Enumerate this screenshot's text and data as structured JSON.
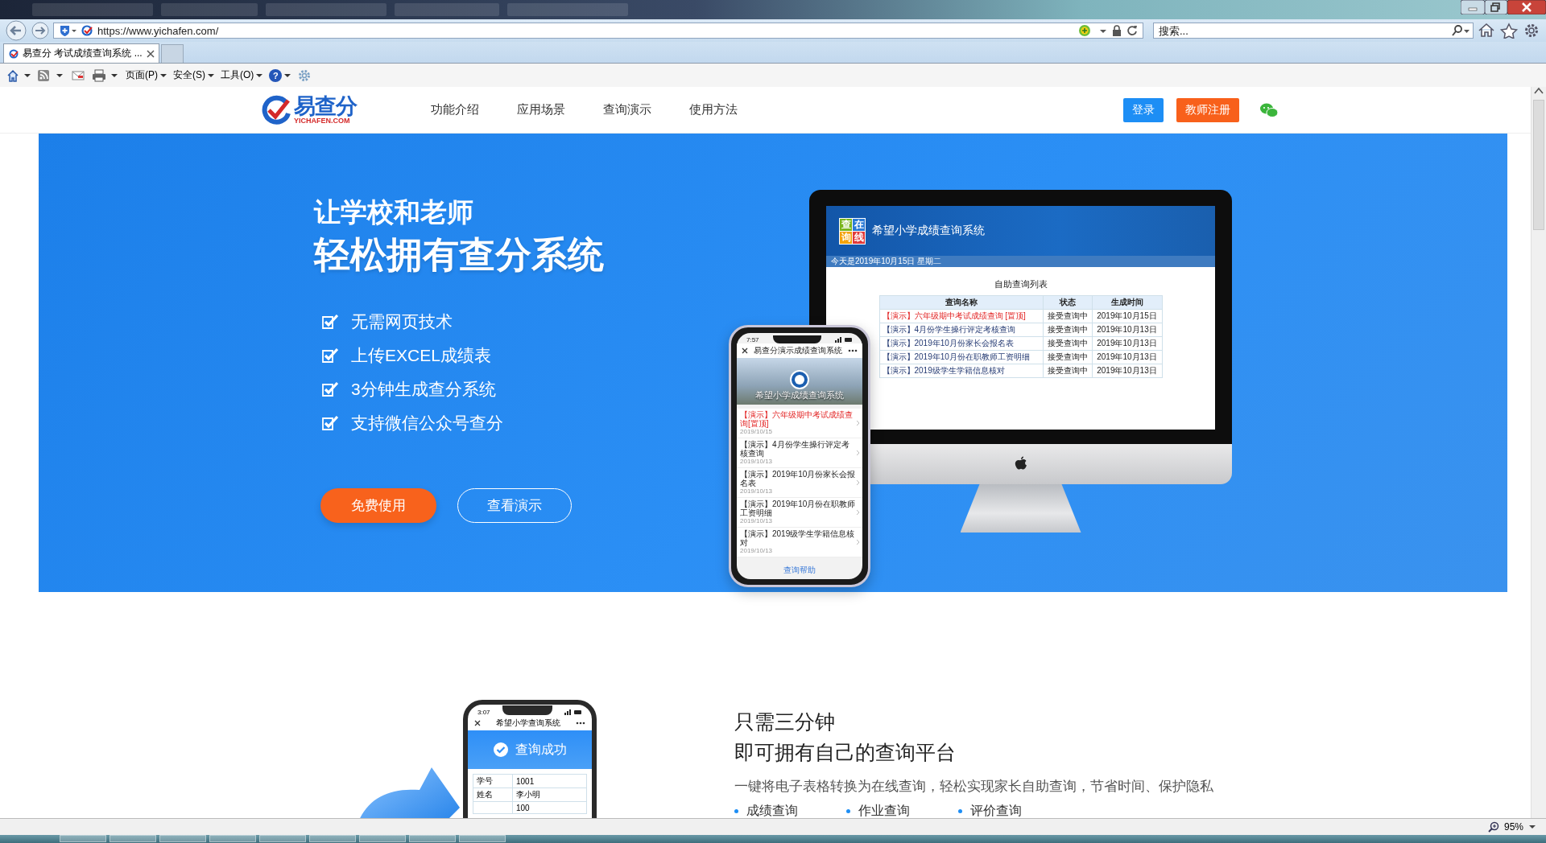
{
  "browser": {
    "address": "https://www.yichafen.com/",
    "search": {
      "placeholder": "搜索..."
    },
    "tabs": [
      {
        "label": "易查分 考试成绩查询系统 ...",
        "selected": true
      }
    ],
    "command_menus": [
      "页面(P)",
      "安全(S)",
      "工具(O)"
    ],
    "help_icon": "?",
    "zoom": "95%"
  },
  "site": {
    "logo_text": "易查分",
    "logo_sub": "YICHAFEN.COM",
    "nav": [
      "功能介绍",
      "应用场景",
      "查询演示",
      "使用方法"
    ],
    "login": "登录",
    "register": "教师注册"
  },
  "hero": {
    "title_small": "让学校和老师",
    "title_large": "轻松拥有查分系统",
    "features": [
      "无需网页技术",
      "上传EXCEL成绩表",
      "3分钟生成查分系统",
      "支持微信公众号查分"
    ],
    "primary_button": "免费使用",
    "secondary_button": "查看演示",
    "monitor": {
      "logo_chars": [
        "查",
        "在",
        "询",
        "线"
      ],
      "title": "希望小学成绩查询系统",
      "date": "今天是2019年10月15日 星期二",
      "list_title": "自助查询列表",
      "columns": [
        "查询名称",
        "状态",
        "生成时间"
      ],
      "rows": [
        {
          "name": "【演示】六年级期中考试成绩查询 [置顶]",
          "status": "接受查询中",
          "time": "2019年10月15日",
          "pinned": true
        },
        {
          "name": "【演示】4月份学生操行评定考核查询",
          "status": "接受查询中",
          "time": "2019年10月13日",
          "pinned": false
        },
        {
          "name": "【演示】2019年10月份家长会报名表",
          "status": "接受查询中",
          "time": "2019年10月13日",
          "pinned": false
        },
        {
          "name": "【演示】2019年10月份在职教师工资明细",
          "status": "接受查询中",
          "time": "2019年10月13日",
          "pinned": false
        },
        {
          "name": "【演示】2019级学生学籍信息核对",
          "status": "接受查询中",
          "time": "2019年10月13日",
          "pinned": false
        }
      ]
    },
    "phone": {
      "time": "7:57",
      "title": "易查分演示成绩查询系统",
      "banner": "希望小学成绩查询系统",
      "items": [
        {
          "name": "【演示】六年级期中考试成绩查询[置顶]",
          "date": "2019/10/15",
          "pinned": true
        },
        {
          "name": "【演示】4月份学生操行评定考核查询",
          "date": "2019/10/13",
          "pinned": false
        },
        {
          "name": "【演示】2019年10月份家长会报名表",
          "date": "2019/10/13",
          "pinned": false
        },
        {
          "name": "【演示】2019年10月份在职教师工资明细",
          "date": "2019/10/13",
          "pinned": false
        },
        {
          "name": "【演示】2019级学生学籍信息核对",
          "date": "2019/10/13",
          "pinned": false
        }
      ],
      "help": "查询帮助"
    }
  },
  "section": {
    "heading_1": "只需三分钟",
    "heading_2": "即可拥有自己的查询平台",
    "description": "一键将电子表格转换为在线查询，轻松实现家长自助查询，节省时间、保护隐私",
    "bullets": [
      "成绩查询",
      "作业查询",
      "评价查询"
    ],
    "phone": {
      "time": "3:07",
      "title": "希望小学查询系统",
      "result": "查询成功",
      "rows": [
        {
          "label": "学号",
          "value": "1001"
        },
        {
          "label": "姓名",
          "value": "李小明"
        },
        {
          "value": "100"
        }
      ]
    }
  }
}
